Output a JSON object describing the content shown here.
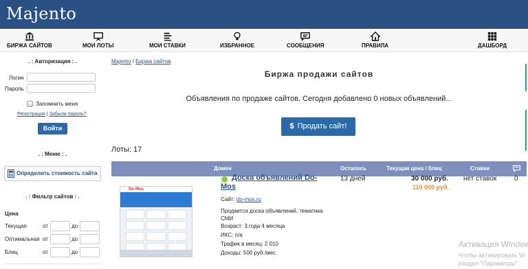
{
  "header": {
    "logo": "Majento"
  },
  "nav": {
    "items": [
      {
        "label": "БИРЖА САЙТОВ",
        "icon": "bank-icon"
      },
      {
        "label": "МОИ ЛОТЫ",
        "icon": "presentation-icon"
      },
      {
        "label": "МОИ СТАВКИ",
        "icon": "list-icon"
      },
      {
        "label": "ИЗБРАННОЕ",
        "icon": "lightbulb-icon"
      },
      {
        "label": "СООБЩЕНИЯ",
        "icon": "chat-icon"
      },
      {
        "label": "ПРАВИЛА",
        "icon": "house-icon"
      },
      {
        "label": "ДАШБОРД",
        "icon": "grid-icon"
      }
    ]
  },
  "sidebar": {
    "auth_title": ". : Авторизация : .",
    "login_label": "Логин",
    "password_label": "Пароль",
    "remember_label": "Запомнить меня",
    "register_link": "Регистрация",
    "separator": "|",
    "forgot_link": "Забыли пароль?",
    "login_button": "Войти",
    "menu_title": ". : Меню : .",
    "cost_button": "Определить стоимость сайта",
    "filter_title": ". : Фильтр сайтов : .",
    "price_label": "Цена",
    "from_label": "от",
    "to_label": "до",
    "filters": [
      "Текущая",
      "Оптимальная",
      "Блиц"
    ]
  },
  "main": {
    "breadcrumb": {
      "home": "Majento",
      "sep": "/",
      "current": "Биржа сайтов"
    },
    "title": "Биржа продажи сайтов",
    "intro": "Объявления по продаже сайтов. Сегодня добавлено 0 новых объявлений...",
    "sell_button": "Продать сайт!",
    "lots_count": "Лоты: 17"
  },
  "table": {
    "columns": {
      "domain": "Домен",
      "left": "Осталось",
      "price": "Текущая цена / блиц",
      "bids": "Ставки"
    },
    "row": {
      "thumb_label": "Do-Mos",
      "title": "Доска объявлений Do-Mos",
      "site_label": "Сайт:",
      "site_link": "do-mos.ru",
      "description": "Продается доска объявлений, тематика СМИ",
      "age": "Возраст: 3 года 4 месяца",
      "iks": "ИКС: n/a",
      "traffic": "Трафик в месяц: 2 010",
      "income": "Доходы: 500 руб./мес.",
      "days_left": "13 дней",
      "current_price": "30 000 руб.",
      "blitz_price": "110 000 руб.",
      "bids": "нет ставок",
      "comments": "0"
    }
  },
  "watermark": {
    "line1": "Активация Windows",
    "line2": "Чтобы активировать W",
    "line3": "раздел \"Параметры\"."
  },
  "colors": {
    "header_bg": "#2b5084",
    "button_bg": "#2b6aa8",
    "table_header": "#7d8fbd",
    "blitz": "#e5902a",
    "status_ok": "#8bcc3d"
  }
}
